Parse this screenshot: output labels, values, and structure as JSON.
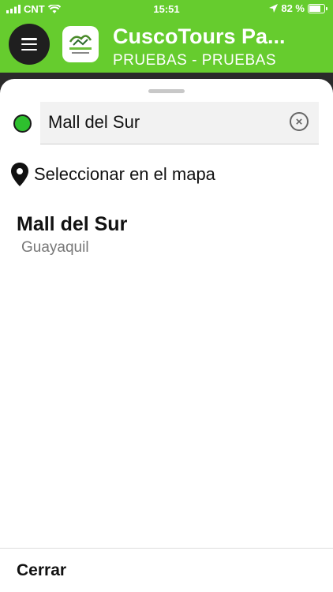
{
  "status_bar": {
    "carrier": "CNT",
    "time": "15:51",
    "battery": "82 %",
    "battery_level": 0.82
  },
  "header": {
    "title": "CuscoTours Pa...",
    "subtitle": "PRUEBAS - PRUEBAS",
    "menu_icon": "hamburger-icon",
    "logo_icon": "cuscotours-logo"
  },
  "sheet": {
    "search": {
      "value": "Mall del Sur",
      "placeholder": ""
    },
    "select_on_map_label": "Seleccionar en el mapa",
    "results": [
      {
        "name": "Mall del Sur",
        "city": "Guayaquil"
      }
    ],
    "close_label": "Cerrar"
  },
  "colors": {
    "brand_green": "#66cc2e",
    "dot_green": "#2ec02e"
  }
}
